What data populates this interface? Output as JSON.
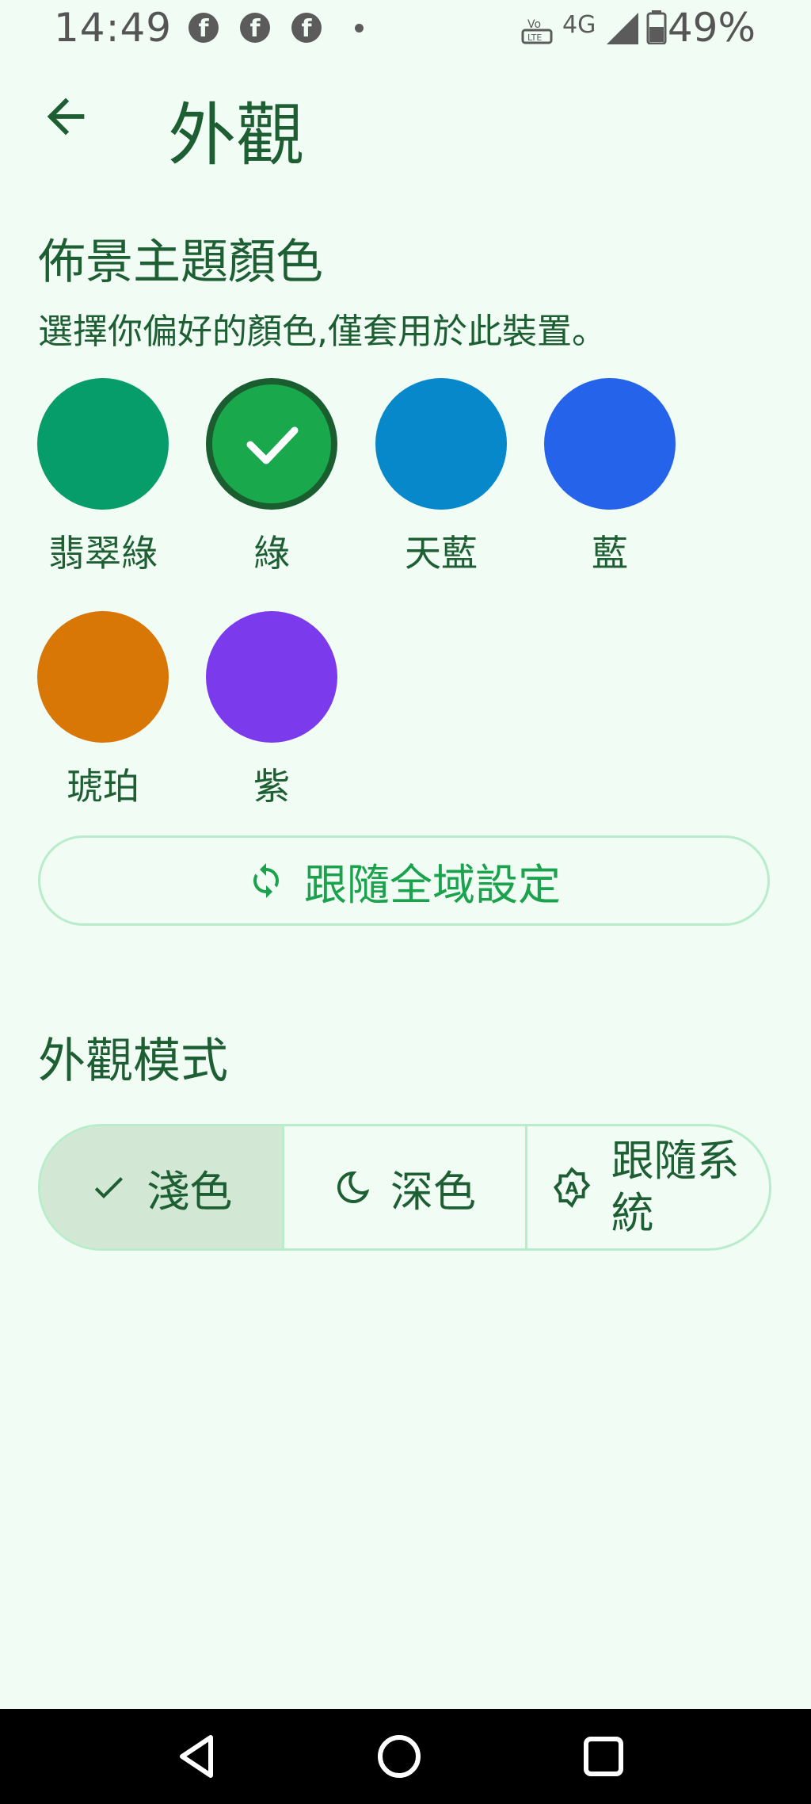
{
  "status_bar": {
    "time": "14:49",
    "network": "4G",
    "battery": "49%",
    "icons": [
      "facebook-icon",
      "facebook-icon",
      "facebook-icon",
      "notification-dot-icon",
      "volte-icon",
      "signal-icon",
      "battery-icon"
    ]
  },
  "header": {
    "title": "外觀",
    "back_icon": "arrow-back-icon"
  },
  "theme_color": {
    "title": "佈景主題顏色",
    "description": "選擇你偏好的顏色,僅套用於此裝置。",
    "swatches": [
      {
        "label": "翡翠綠",
        "color": "#069d6b",
        "selected": false
      },
      {
        "label": "綠",
        "color": "#1aa84d",
        "selected": true
      },
      {
        "label": "天藍",
        "color": "#0788cb",
        "selected": false
      },
      {
        "label": "藍",
        "color": "#2563eb",
        "selected": false
      },
      {
        "label": "琥珀",
        "color": "#d97706",
        "selected": false
      },
      {
        "label": "紫",
        "color": "#7c3aed",
        "selected": false
      }
    ],
    "follow_global": "跟隨全域設定"
  },
  "appearance_mode": {
    "title": "外觀模式",
    "options": [
      {
        "label": "淺色",
        "icon": "check-icon",
        "selected": true
      },
      {
        "label": "深色",
        "icon": "moon-icon",
        "selected": false
      },
      {
        "label": "跟隨系統",
        "icon": "auto-brightness-icon",
        "selected": false
      }
    ]
  },
  "colors": {
    "background": "#f0fcf4",
    "text": "#1d5e33",
    "accent": "#1aa24d",
    "outline": "#b8ecca",
    "selected_segment": "#d3e8d4"
  },
  "nav_bar": {
    "icons": [
      "nav-back-icon",
      "nav-home-icon",
      "nav-recents-icon"
    ]
  }
}
